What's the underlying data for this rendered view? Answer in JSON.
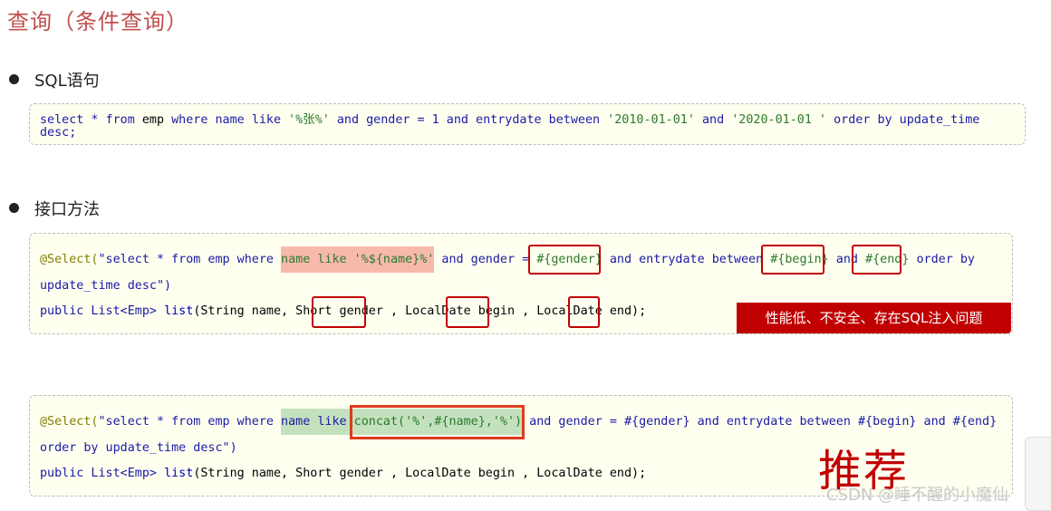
{
  "title": "查询（条件查询）",
  "sections": {
    "sql": "SQL语句",
    "interface": "接口方法"
  },
  "sql_block": {
    "l1_a": "select * ",
    "l1_b": "from",
    "l1_c": " emp ",
    "l1_d": "where",
    "l1_e": " ",
    "l1_f": "name",
    "l1_g": " ",
    "l1_h": "like",
    "l1_i": " '%张%' ",
    "l1_j": "and",
    "l1_k": " ",
    "l1_l": "gender",
    "l1_m": " = 1 ",
    "l1_n": "and",
    "l1_o": " ",
    "l1_p": "entrydate",
    "l1_q": " ",
    "l1_r": "between",
    "l1_s": " '2010-01-01' ",
    "l1_t": "and",
    "l1_u": " '2020-01-01 ' ",
    "l1_v": "order by",
    "l1_w": " ",
    "l1_x": "update_time",
    "l2": "desc;"
  },
  "interface_block": {
    "l1_annot": "@Select(",
    "l1_str1": "\"select * from emp where ",
    "l1_hl": "name like '%${name}%'",
    "l1_str2": " and gender = ",
    "l1_gender": "#{gender}",
    "l1_str3": " and entrydate between ",
    "l1_begin": "#{begin}",
    "l1_str4": " and ",
    "l1_end": "#{end}",
    "l1_str5": " order by",
    "l2": "update_time desc\")",
    "l3_a": "public List<Emp> ",
    "l3_fn": "list",
    "l3_b": "(String name, Short gender , LocalDate begin , LocalDate end);"
  },
  "warning": "性能低、不安全、存在SQL注入问题",
  "recommended_block": {
    "l1_annot": "@Select(",
    "l1_str1": "\"select * from emp where ",
    "l1_hl": "name like ",
    "l1_concat": "concat('%',#{name},'%')",
    "l1_str2": " and gender = #{gender} and entrydate between #{begin} and #{end}",
    "l2": "order by update_time desc\")",
    "l3_a": "public List<Emp> ",
    "l3_fn": "list",
    "l3_b": "(String name, Short gender , LocalDate begin , LocalDate end);"
  },
  "recommend_label": "推荐",
  "watermark": "CSDN @睡不醒的小魔仙",
  "colors": {
    "title": "#c0504d",
    "warning_bg": "#c00000",
    "highlight_red": "#f8b9ad",
    "highlight_green": "#c4e1bd",
    "code_bg": "#fffff0"
  }
}
